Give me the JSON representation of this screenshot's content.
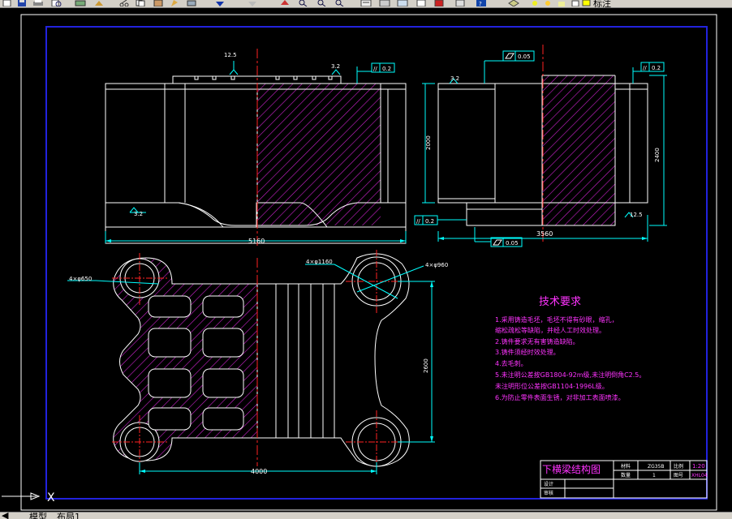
{
  "toolbar": {
    "layer_name": "标注",
    "buttons": [
      "save-icon",
      "print-icon",
      "preview-icon",
      "plot-icon",
      "cut-icon",
      "copy-icon",
      "paste-icon",
      "match-icon",
      "undo-icon",
      "redo-icon",
      "pan-icon",
      "zoom-realtime-icon",
      "zoom-window-icon",
      "zoom-previous-icon",
      "properties-icon",
      "design-center-icon",
      "tool-palette-icon",
      "markup-icon",
      "help-icon",
      "layer-manager-icon",
      "layer-state-icon"
    ]
  },
  "drawing": {
    "front_view": {
      "roughness_top_left": "12.5",
      "roughness_top_right": "3.2",
      "parallelism": "0.2",
      "roughness_bottom": "3.2",
      "width_dim": "5160"
    },
    "side_view": {
      "flatness_top": "0.05",
      "parallelism": "0.2",
      "roughness_left": "3.2",
      "height_left": "2000",
      "height_right": "2400",
      "parallelism_bottom": "0.2",
      "roughness_right": "12.5",
      "flatness_bottom": "0.05",
      "width_dim": "3560"
    },
    "plan_view": {
      "hole_small": "4×φ650",
      "hole_mid": "4×φ1160",
      "hole_large": "4×φ960",
      "height_dim": "2600",
      "width_dim": "4000"
    },
    "tech_requirements": {
      "title": "技术要求",
      "lines": [
        "1.采用铸造毛坯，毛坯不得有砂眼，缩孔，",
        "  缩松疏松等缺陷，并经人工时效处理。",
        "2.铸件要求无有害铸造缺陷。",
        "3.铸件须经时效处理。",
        "4.去毛刺。",
        "5.未注明公差按GB1804-92m级,未注明倒角C2.5。",
        "未注明形位公差按GB1104-1996L级。",
        "6.为防止零件表面生锈，对非加工表面喷漆。"
      ]
    },
    "title_block": {
      "part_name": "下横梁结构图",
      "material_label": "材料",
      "material_value": "ZG35B",
      "scale_label": "比例",
      "scale_value": "1:20",
      "qty_label": "数量",
      "qty_value": "1",
      "drawing_no_label": "图号",
      "drawing_no_value": "XHL04",
      "design_label": "设计",
      "review_label": "审核"
    }
  },
  "tabs": {
    "model": "模型",
    "layout": "布局1"
  },
  "ucs": {
    "x_axis": "X"
  },
  "colors": {
    "background": "#000000",
    "border": "#2222dd",
    "outline": "#ffffff",
    "hatch": "#cc22cc",
    "dimension": "#00ffff",
    "centerline": "#ff2222",
    "text_magenta": "#ff33ff"
  }
}
